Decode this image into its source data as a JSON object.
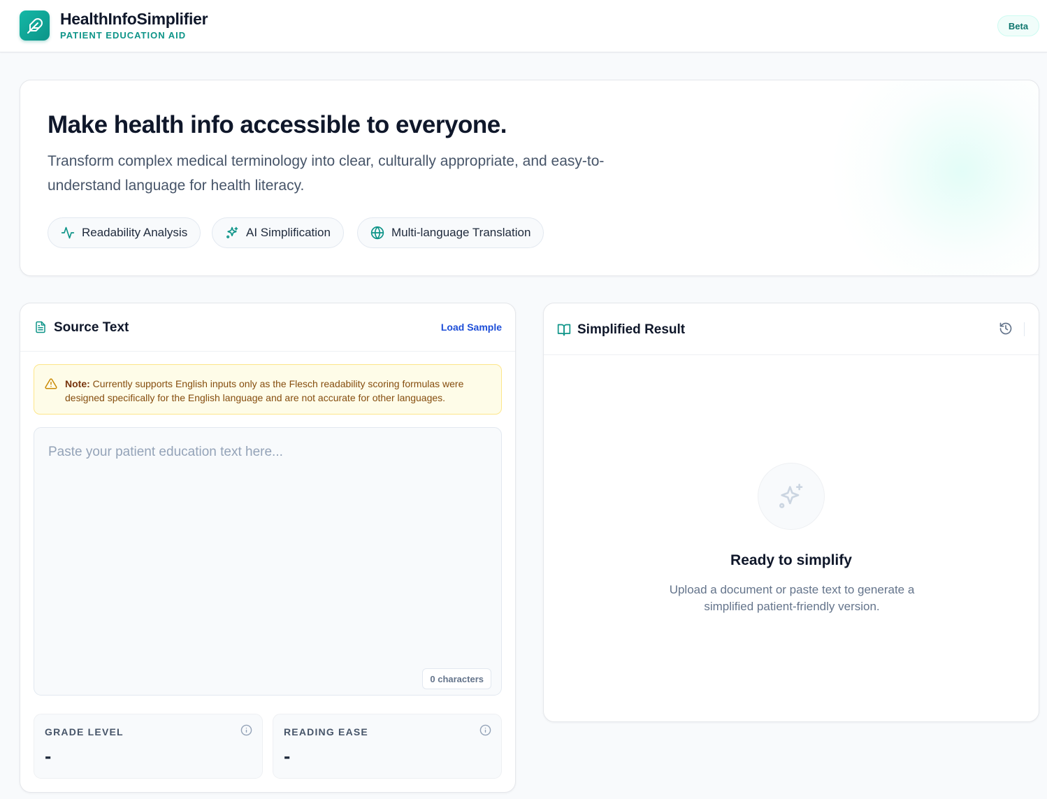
{
  "header": {
    "app_name": "HealthInfoSimplifier",
    "app_subtitle": "PATIENT EDUCATION AID",
    "badge": "Beta",
    "logo_icon": "feather-icon"
  },
  "hero": {
    "title": "Make health info accessible to everyone.",
    "description": "Transform complex medical terminology into clear, culturally appropriate, and easy-to-understand language for health literacy.",
    "features": [
      {
        "label": "Readability Analysis",
        "icon": "activity-icon"
      },
      {
        "label": "AI Simplification",
        "icon": "sparkles-icon"
      },
      {
        "label": "Multi-language Translation",
        "icon": "globe-icon"
      }
    ]
  },
  "source": {
    "title": "Source Text",
    "load_sample": "Load Sample",
    "note_label": "Note:",
    "note_text": "Currently supports English inputs only as the Flesch readability scoring formulas were designed specifically for the English language and are not accurate for other languages.",
    "placeholder": "Paste your patient education text here...",
    "value": "",
    "char_count": "0 characters",
    "stats": [
      {
        "label": "GRADE LEVEL",
        "value": "-"
      },
      {
        "label": "READING EASE",
        "value": "-"
      }
    ]
  },
  "result": {
    "title": "Simplified Result",
    "empty_title": "Ready to simplify",
    "empty_desc": "Upload a document or paste text to generate a simplified patient-friendly version."
  },
  "colors": {
    "brand": "#0d9488",
    "link": "#1d4ed8",
    "warning_bg": "#fefce8",
    "warning_text": "#854d0e"
  }
}
